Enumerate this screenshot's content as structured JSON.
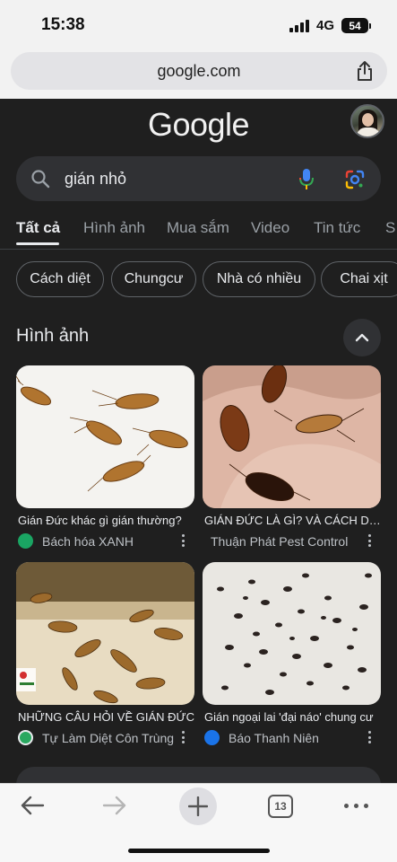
{
  "status_bar": {
    "time": "15:38",
    "network": "4G",
    "battery": "54"
  },
  "browser": {
    "url": "google.com",
    "share_icon": "share-icon"
  },
  "google": {
    "logo": "Google",
    "search": {
      "query": "gián nhỏ"
    },
    "tabs": [
      {
        "label": "Tất cả",
        "active": true
      },
      {
        "label": "Hình ảnh"
      },
      {
        "label": "Mua sắm"
      },
      {
        "label": "Video"
      },
      {
        "label": "Tin tức"
      },
      {
        "label": "S"
      }
    ],
    "chips": [
      "Cách diệt",
      "Chungcư",
      "Nhà có nhiều",
      "Chai xịt"
    ],
    "images_section": {
      "title": "Hình ảnh",
      "results": [
        {
          "title": "Gián Đức khác gì gián thường?",
          "source": "Bách hóa XANH",
          "favicon_color": "#1aa563"
        },
        {
          "title": "GIÁN ĐỨC LÀ GÌ? VÀ CÁCH DIỆT",
          "source": "Thuận Phát Pest Control",
          "favicon_color": "#e8eaed"
        },
        {
          "title": "NHỮNG CÂU HỎI VỀ GIÁN ĐỨC",
          "source": "Tự Làm Diệt Côn Trùng",
          "favicon_color": "#2aa860"
        },
        {
          "title": "Gián ngoại lai 'đại náo' chung cư",
          "source": "Báo Thanh Niên",
          "favicon_color": "#1a73e8"
        }
      ]
    }
  },
  "toolbar": {
    "tab_count": "13"
  },
  "colors": {
    "page_bg": "#1f1f1f",
    "surface": "#303134",
    "text": "#e8eaed",
    "muted": "#9aa0a6"
  }
}
